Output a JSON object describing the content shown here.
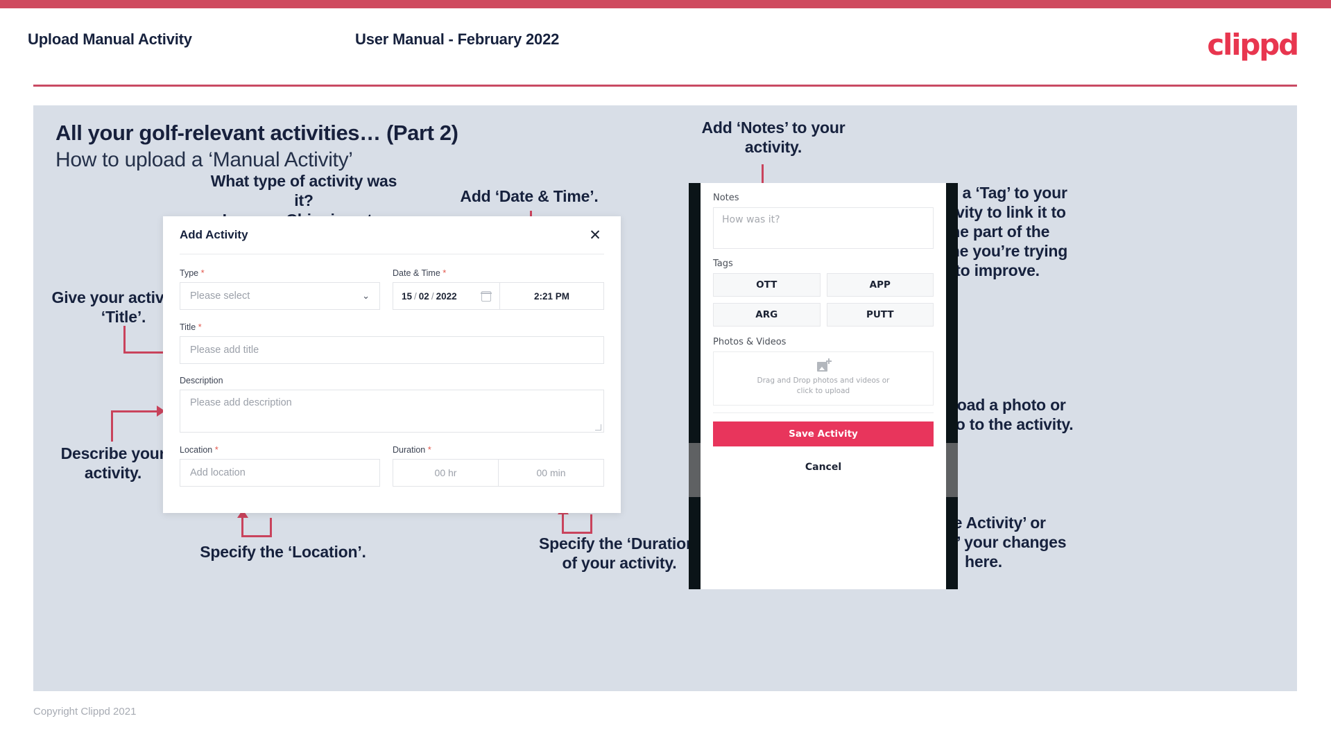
{
  "header": {
    "title": "Upload Manual Activity",
    "subtitle": "User Manual - February 2022",
    "logo": "clippd"
  },
  "slide": {
    "title": "All your golf-relevant activities… (Part 2)",
    "subtitle": "How to upload a ‘Manual Activity’"
  },
  "annotations": {
    "type": "What type of activity was it?\nLesson, Chipping etc.",
    "date_time": "Add ‘Date & Time’.",
    "notes": "Add ‘Notes’ to your\nactivity.",
    "tag": "Add a ‘Tag’ to your\nactivity to link it to\nthe part of the\ngame you’re trying\nto improve.",
    "title": "Give your activity a\n‘Title’.",
    "description": "Describe your\nactivity.",
    "location": "Specify the ‘Location’.",
    "duration": "Specify the ‘Duration’\nof your activity.",
    "upload": "Upload a photo or\nvideo to the activity.",
    "save_cancel": "‘Save Activity’ or\n‘Cancel’ your changes\nhere."
  },
  "dialog": {
    "title": "Add Activity",
    "close_icon": "close-icon",
    "fields": {
      "type_label": "Type",
      "type_placeholder": "Please select",
      "datetime_label": "Date & Time",
      "date_day": "15",
      "date_month": "02",
      "date_year": "2022",
      "time_value": "2:21 PM",
      "title_label": "Title",
      "title_placeholder": "Please add title",
      "description_label": "Description",
      "description_placeholder": "Please add description",
      "location_label": "Location",
      "location_placeholder": "Add location",
      "duration_label": "Duration",
      "duration_hr": "00 hr",
      "duration_min": "00 min"
    },
    "required_marker": "*"
  },
  "phone": {
    "notes_label": "Notes",
    "notes_placeholder": "How was it?",
    "tags_label": "Tags",
    "tags": [
      "OTT",
      "APP",
      "ARG",
      "PUTT"
    ],
    "photos_label": "Photos & Videos",
    "dropzone_line1": "Drag and Drop photos and videos or",
    "dropzone_line2": "click to upload",
    "save_label": "Save Activity",
    "cancel_label": "Cancel"
  },
  "footer": {
    "copyright": "Copyright Clippd 2021"
  },
  "colors": {
    "accent": "#e8355c",
    "arrow": "#c9435c",
    "top_bar": "#cf4a5f",
    "slide_bg": "#d8dee7",
    "text_dark": "#16213d"
  }
}
